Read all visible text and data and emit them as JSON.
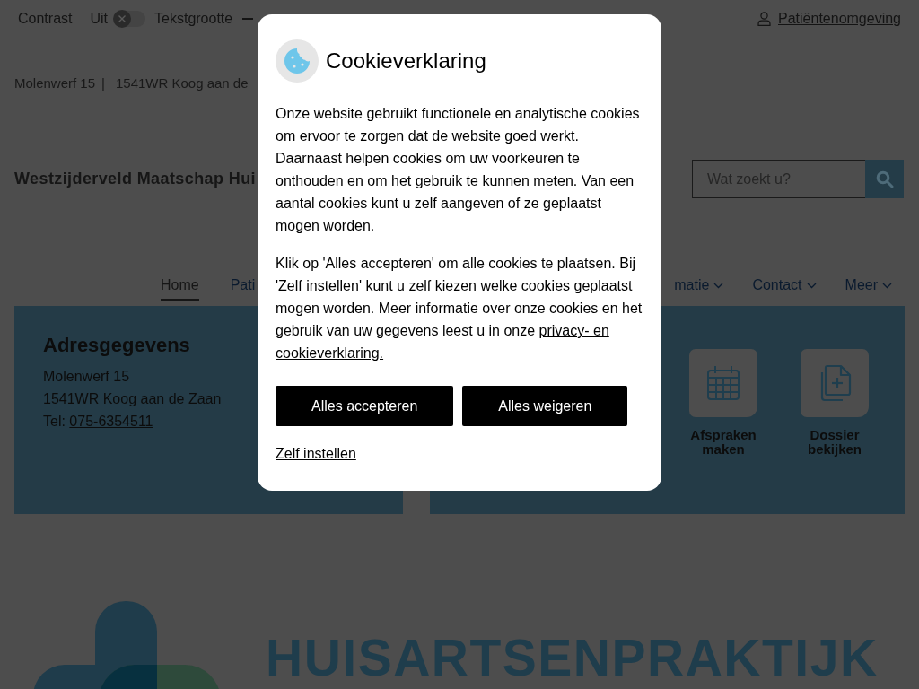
{
  "top_bar": {
    "contrast": {
      "label": "Contrast",
      "state_label": "Uit",
      "on": false
    },
    "text_size": {
      "label": "Tekstgrootte"
    },
    "account_link": "Patiëntenomgeving"
  },
  "address_bar": {
    "street": "Molenwerf 15",
    "separator": "|",
    "city": "1541WR Koog aan de"
  },
  "header": {
    "title": "Westzijderveld Maatschap Hui",
    "search": {
      "placeholder": "Wat zoekt u?"
    }
  },
  "nav": {
    "items_left": [
      {
        "label": "Home",
        "selected": true,
        "has_menu": false
      },
      {
        "label": "Pati",
        "selected": false,
        "has_menu": false
      }
    ],
    "items_right": [
      {
        "label": "matie",
        "selected": false,
        "has_menu": true
      },
      {
        "label": "Contact",
        "selected": false,
        "has_menu": true
      },
      {
        "label": "Meer",
        "selected": false,
        "has_menu": true
      }
    ]
  },
  "address_panel": {
    "title": "Adresgegevens",
    "lines": [
      "Molenwerf 15",
      "1541WR Koog aan de Zaan"
    ],
    "phone": {
      "label": "Tel:",
      "number": "075-6354511"
    }
  },
  "quick_links": [
    {
      "label": "Afspraken maken",
      "kind": "calendar"
    },
    {
      "label": "Dossier bekijken",
      "kind": "file"
    }
  ],
  "logo": {
    "wordmark": "HUISARTSENPRAKTIJK"
  },
  "cookie_dialog": {
    "title": "Cookieverklaring",
    "paragraphs": [
      {
        "text": "Onze website gebruikt functionele en analytische cookies om ervoor te zorgen dat de website goed werkt. Daarnaast helpen cookies om uw voorkeuren te onthouden en om het gebruik te kunnen meten. Van een aantal cookies kunt u zelf aangeven of ze geplaatst mogen worden."
      },
      {
        "text": "Klik op 'Alles accepteren' om alle cookies te plaatsen. Bij 'Zelf instellen' kunt u zelf kiezen welke cookies geplaatst mogen worden. Meer informatie over onze cookies en het gebruik van uw gegevens leest u in onze",
        "link": "privacy- en cookieverklaring."
      }
    ],
    "buttons": [
      "Alles accepteren",
      "Alles weigeren"
    ],
    "settings_link": "Zelf instellen"
  }
}
